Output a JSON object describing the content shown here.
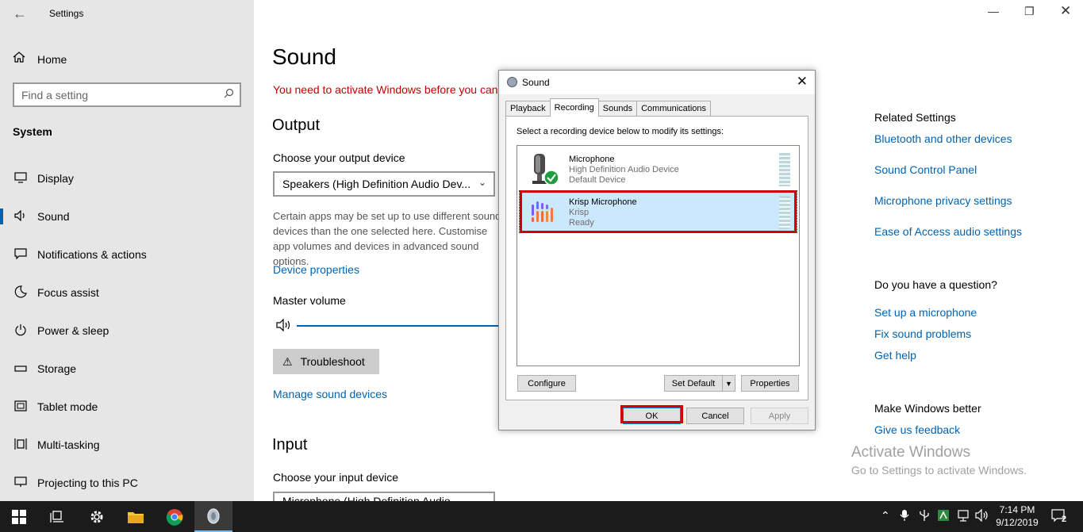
{
  "settings": {
    "window_title": "Settings",
    "back_icon": "back-arrow-icon",
    "home_label": "Home",
    "search_placeholder": "Find a setting",
    "section": "System",
    "nav_items": [
      {
        "label": "Display",
        "icon": "display-icon",
        "selected": false
      },
      {
        "label": "Sound",
        "icon": "speaker-icon",
        "selected": true
      },
      {
        "label": "Notifications & actions",
        "icon": "notifications-icon",
        "selected": false
      },
      {
        "label": "Focus assist",
        "icon": "moon-icon",
        "selected": false
      },
      {
        "label": "Power & sleep",
        "icon": "power-icon",
        "selected": false
      },
      {
        "label": "Storage",
        "icon": "storage-icon",
        "selected": false
      },
      {
        "label": "Tablet mode",
        "icon": "tablet-icon",
        "selected": false
      },
      {
        "label": "Multi-tasking",
        "icon": "multitasking-icon",
        "selected": false
      },
      {
        "label": "Projecting to this PC",
        "icon": "projecting-icon",
        "selected": false
      }
    ]
  },
  "sound_page": {
    "title": "Sound",
    "activation_warning": "You need to activate Windows before you can",
    "output_heading": "Output",
    "output_device_label": "Choose your output device",
    "output_device_value": "Speakers (High Definition Audio Dev...",
    "output_description": "Certain apps may be set up to use different sound devices than the one selected here. Customise app volumes and devices in advanced sound options.",
    "device_properties_link": "Device properties",
    "master_volume_label": "Master volume",
    "troubleshoot_label": "Troubleshoot",
    "manage_devices_link": "Manage sound devices",
    "input_heading": "Input",
    "input_device_label": "Choose your input device",
    "input_device_value": "Microphone (High Definition Audio..."
  },
  "related": {
    "title": "Related Settings",
    "links": [
      "Bluetooth and other devices",
      "Sound Control Panel",
      "Microphone privacy settings",
      "Ease of Access audio settings"
    ],
    "question_title": "Do you have a question?",
    "question_links": [
      "Set up a microphone",
      "Fix sound problems",
      "Get help"
    ],
    "better_title": "Make Windows better",
    "feedback_link": "Give us feedback"
  },
  "watermark": {
    "line1": "Activate Windows",
    "line2": "Go to Settings to activate Windows."
  },
  "dialog": {
    "title": "Sound",
    "tabs": [
      "Playback",
      "Recording",
      "Sounds",
      "Communications"
    ],
    "active_tab": "Recording",
    "instruction": "Select a recording device below to modify its settings:",
    "devices": [
      {
        "name": "Microphone",
        "driver": "High Definition Audio Device",
        "status": "Default Device",
        "icon": "microphone-icon",
        "default": true
      },
      {
        "name": "Krisp Microphone",
        "driver": "Krisp",
        "status": "Ready",
        "icon": "krisp-icon",
        "selected": true
      }
    ],
    "buttons": {
      "configure": "Configure",
      "set_default": "Set Default",
      "properties": "Properties",
      "ok": "OK",
      "cancel": "Cancel",
      "apply": "Apply"
    }
  },
  "taskbar": {
    "time": "7:14 PM",
    "date": "9/12/2019",
    "notification_count": "2"
  },
  "colors": {
    "accent": "#0063b1",
    "warning": "#c40000",
    "highlight_box": "#d40000",
    "selection": "#cce8ff"
  }
}
